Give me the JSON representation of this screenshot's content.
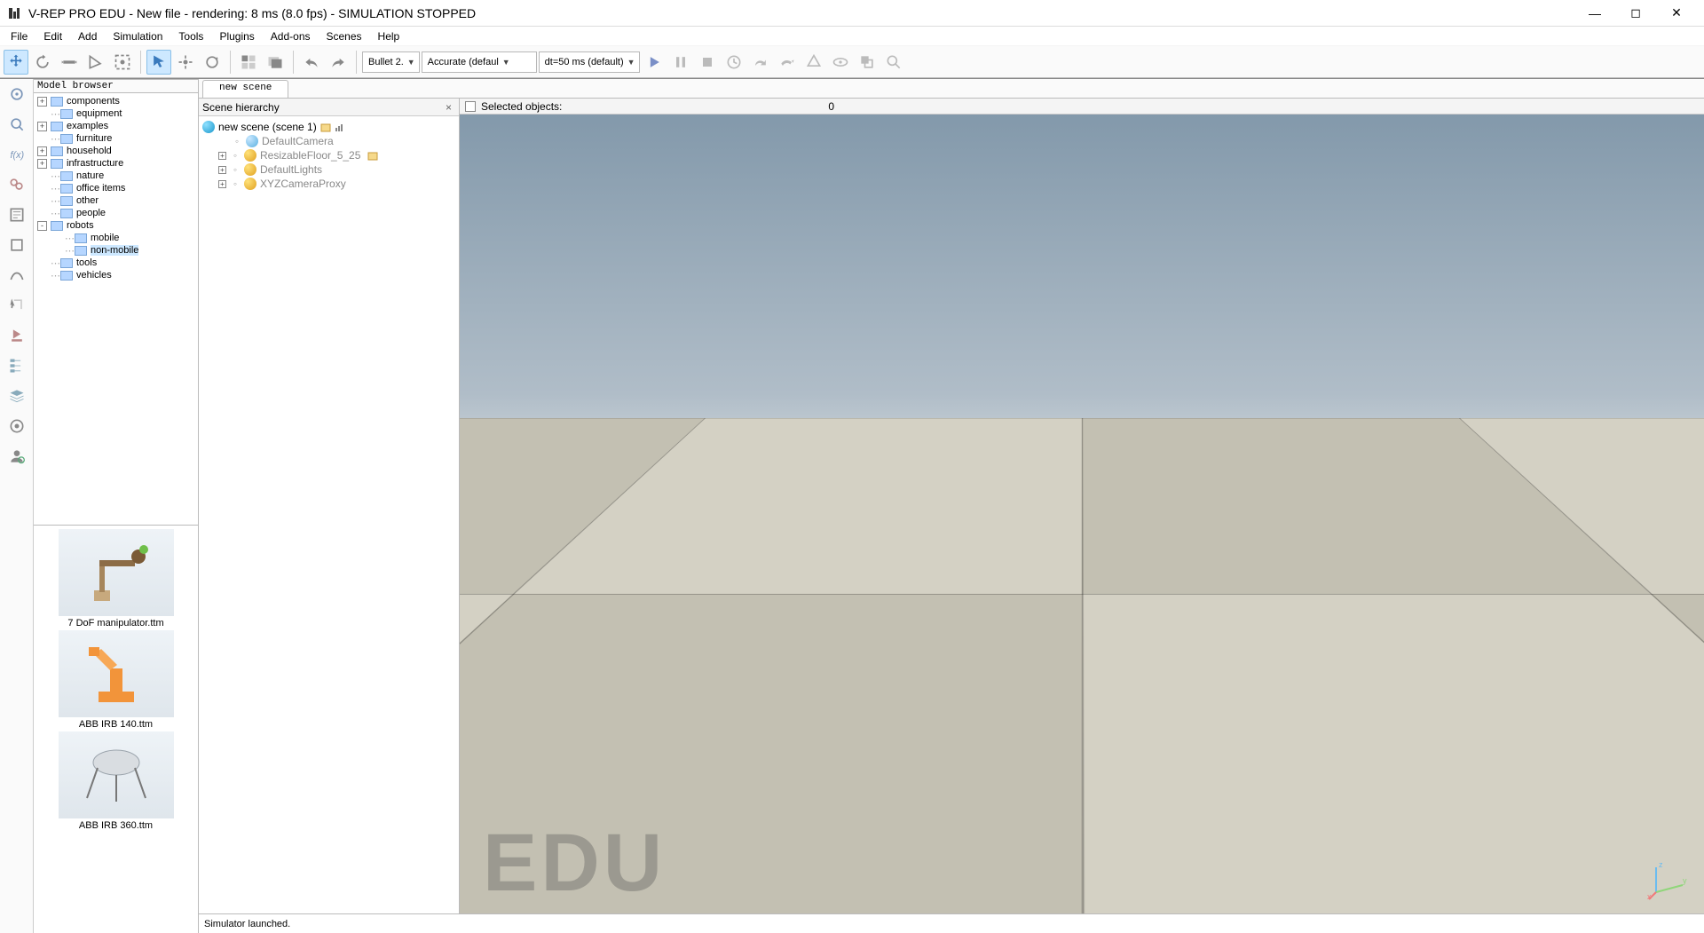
{
  "window": {
    "title": "V-REP PRO EDU - New file - rendering: 8 ms (8.0 fps) - SIMULATION STOPPED"
  },
  "menu": [
    "File",
    "Edit",
    "Add",
    "Simulation",
    "Tools",
    "Plugins",
    "Add-ons",
    "Scenes",
    "Help"
  ],
  "toolbar": {
    "engine": "Bullet 2.",
    "accuracy": "Accurate (defaul",
    "timestep": "dt=50 ms (default)"
  },
  "modelbrowser": {
    "title": "Model browser",
    "items": [
      {
        "label": "components",
        "expander": "+",
        "indent": 0
      },
      {
        "label": "equipment",
        "expander": "",
        "indent": 0
      },
      {
        "label": "examples",
        "expander": "+",
        "indent": 0
      },
      {
        "label": "furniture",
        "expander": "",
        "indent": 0
      },
      {
        "label": "household",
        "expander": "+",
        "indent": 0
      },
      {
        "label": "infrastructure",
        "expander": "+",
        "indent": 0
      },
      {
        "label": "nature",
        "expander": "",
        "indent": 0
      },
      {
        "label": "office items",
        "expander": "",
        "indent": 0
      },
      {
        "label": "other",
        "expander": "",
        "indent": 0
      },
      {
        "label": "people",
        "expander": "",
        "indent": 0
      },
      {
        "label": "robots",
        "expander": "-",
        "indent": 0
      },
      {
        "label": "mobile",
        "expander": "",
        "indent": 1
      },
      {
        "label": "non-mobile",
        "expander": "",
        "indent": 1,
        "selected": true
      },
      {
        "label": "tools",
        "expander": "",
        "indent": 0
      },
      {
        "label": "vehicles",
        "expander": "",
        "indent": 0
      }
    ],
    "thumbs": [
      {
        "caption": "7 DoF manipulator.ttm"
      },
      {
        "caption": "ABB IRB 140.ttm"
      },
      {
        "caption": "ABB IRB 360.ttm"
      }
    ]
  },
  "tabs": {
    "active": "new scene"
  },
  "hierarchy": {
    "title": "Scene hierarchy",
    "root": "new scene (scene 1)",
    "items": [
      {
        "label": "DefaultCamera",
        "icon": "cam",
        "exp": ""
      },
      {
        "label": "ResizableFloor_5_25",
        "icon": "obj",
        "exp": "+",
        "extra": true
      },
      {
        "label": "DefaultLights",
        "icon": "obj",
        "exp": "+"
      },
      {
        "label": "XYZCameraProxy",
        "icon": "obj",
        "exp": "+"
      }
    ]
  },
  "viewport": {
    "selectedLabel": "Selected objects:",
    "selectedCount": "0",
    "watermark": "EDU"
  },
  "status": "Simulator launched."
}
